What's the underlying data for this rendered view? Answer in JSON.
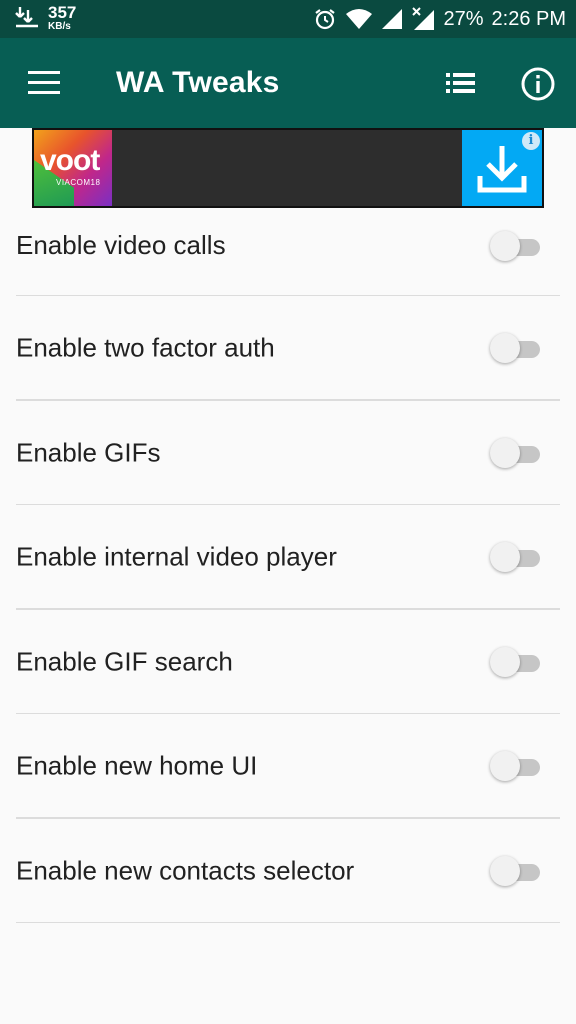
{
  "status_bar": {
    "speed_value": "357",
    "speed_unit": "KB/s",
    "battery": "27%",
    "time": "2:26 PM",
    "icons": [
      "download-notification-icon",
      "alarm-icon",
      "wifi-icon",
      "signal-icon",
      "signal-no-data-icon"
    ]
  },
  "app_bar": {
    "title": "WA Tweaks",
    "icons": [
      "menu-icon",
      "list-icon",
      "info-icon"
    ],
    "color": "#075e54"
  },
  "ad": {
    "brand": "voot",
    "sub": "VIACOM18",
    "info_glyph": "i",
    "cta_icon": "download-icon",
    "cta_color": "#03a9f4"
  },
  "settings": [
    {
      "label": "Enable video calls",
      "enabled": false
    },
    {
      "label": "Enable two factor auth",
      "enabled": false
    },
    {
      "label": "Enable GIFs",
      "enabled": false
    },
    {
      "label": "Enable internal video player",
      "enabled": false
    },
    {
      "label": "Enable GIF search",
      "enabled": false
    },
    {
      "label": "Enable new home UI",
      "enabled": false
    },
    {
      "label": "Enable new contacts selector",
      "enabled": false
    }
  ]
}
